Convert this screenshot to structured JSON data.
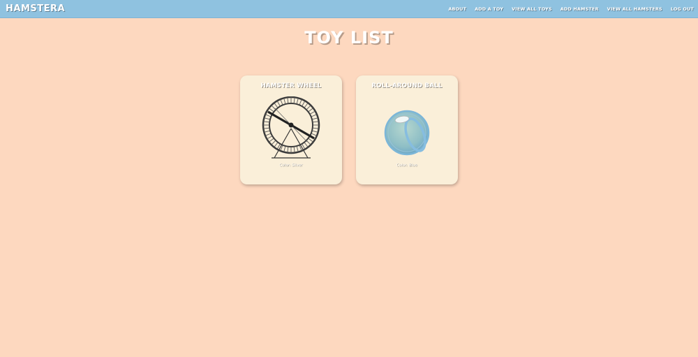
{
  "navbar": {
    "brand": "HAMSTERA",
    "links": [
      {
        "label": "ABOUT"
      },
      {
        "label": "ADD A TOY"
      },
      {
        "label": "VIEW ALL TOYS"
      },
      {
        "label": "ADD HAMSTER"
      },
      {
        "label": "VIEW ALL HAMSTERS"
      },
      {
        "label": "LOG OUT"
      }
    ]
  },
  "page": {
    "title": "TOY LIST"
  },
  "toys": [
    {
      "name": "HAMSTER WHEEL",
      "color_text": "Color: Silver",
      "image_icon": "hamster-wheel-icon"
    },
    {
      "name": "ROLL-AROUND BALL",
      "color_text": "Color: Blue",
      "image_icon": "hamster-ball-icon"
    }
  ],
  "colors": {
    "background": "#fdd8bf",
    "navbar": "#8fc2e0",
    "card": "#faefd9",
    "text": "#ffffff"
  }
}
